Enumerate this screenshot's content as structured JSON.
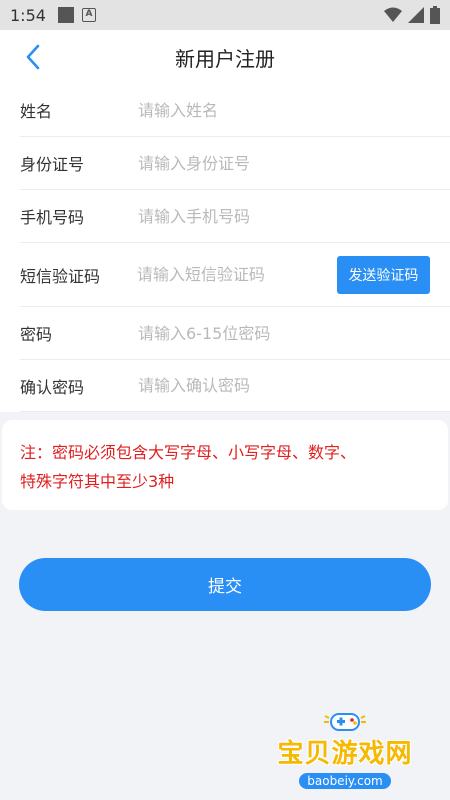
{
  "status_bar": {
    "time": "1:54",
    "a_icon_letter": "A"
  },
  "nav": {
    "title": "新用户注册",
    "back_icon": "chevron-left-icon"
  },
  "form": {
    "fields": [
      {
        "label": "姓名",
        "placeholder": "请输入姓名",
        "value": ""
      },
      {
        "label": "身份证号",
        "placeholder": "请输入身份证号",
        "value": ""
      },
      {
        "label": "手机号码",
        "placeholder": "请输入手机号码",
        "value": ""
      },
      {
        "label": "短信验证码",
        "placeholder": "请输入短信验证码",
        "value": ""
      },
      {
        "label": "密码",
        "placeholder": "请输入6-15位密码",
        "value": ""
      },
      {
        "label": "确认密码",
        "placeholder": "请输入确认密码",
        "value": ""
      }
    ],
    "send_code_label": "发送验证码"
  },
  "notice": {
    "line1": "注：密码必须包含大写字母、小写字母、数字、",
    "line2": "特殊字符其中至少3种"
  },
  "submit_label": "提交",
  "watermark": {
    "brand": "宝贝游戏网",
    "url": "baobeiy.com"
  },
  "colors": {
    "accent": "#2a8ff5",
    "notice": "#e02020",
    "watermark": "#f6b800"
  }
}
